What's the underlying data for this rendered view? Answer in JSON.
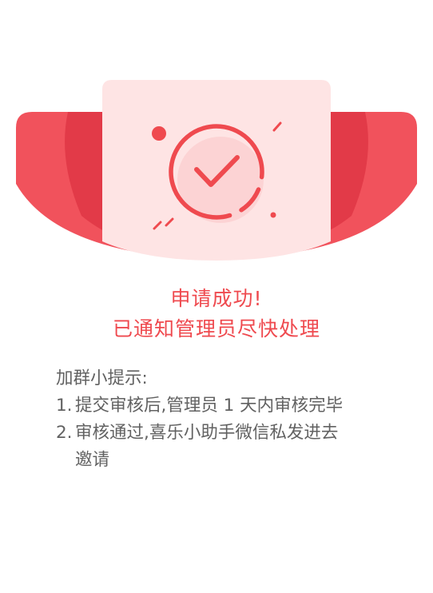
{
  "result": {
    "title_line1": "申请成功!",
    "title_line2": "已通知管理员尽快处理"
  },
  "tips": {
    "heading": "加群小提示:",
    "items": [
      {
        "number": "1.",
        "text": "提交审核后,管理员 1 天内审核完毕"
      },
      {
        "number": "2.",
        "text": "审核通过,喜乐小助手微信私发进去",
        "continuation": "邀请"
      }
    ]
  },
  "colors": {
    "accent": "#ef4a4f",
    "ribbon": "#f1525c",
    "ribbon_dark": "#e23a48",
    "card_bg": "#fee4e4",
    "text_secondary": "#616161"
  },
  "icons": {
    "hero": "success-check-circle-icon"
  }
}
